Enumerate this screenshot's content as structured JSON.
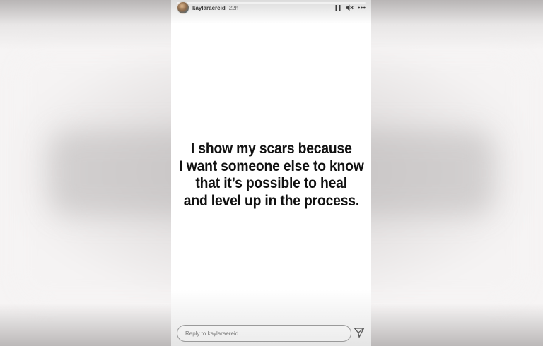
{
  "story": {
    "username": "kaylaraereid",
    "time": "22h",
    "progress": 1.0,
    "quote_lines": [
      "I show my scars because",
      "I want someone else to know",
      "that it’s possible to heal",
      "and level up in the process."
    ]
  },
  "controls": {
    "pause_icon": "pause-icon",
    "mute_icon": "speaker-muted-icon",
    "more_icon": "more-options-icon"
  },
  "reply": {
    "placeholder": "Reply to kaylaraereid..."
  },
  "send_icon": "send-icon",
  "colors": {
    "background": "#f6f4f4",
    "story_bg": "#ffffff",
    "text": "#111111"
  }
}
